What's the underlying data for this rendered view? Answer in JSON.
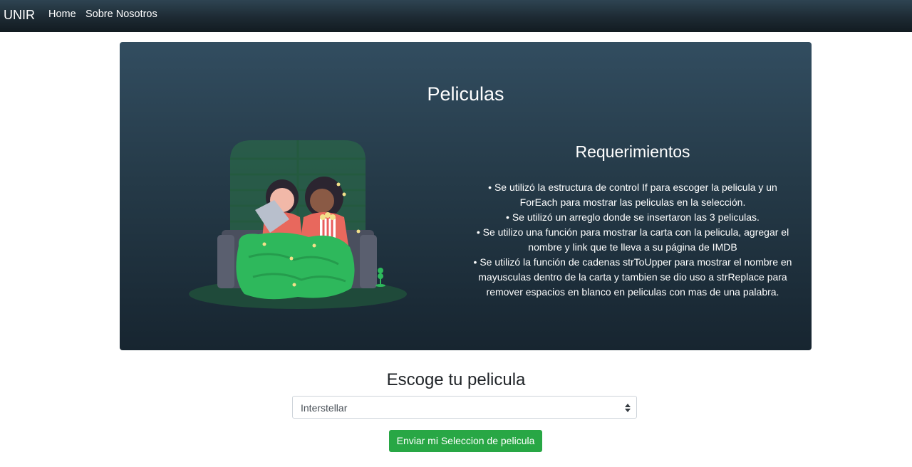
{
  "navbar": {
    "brand": "UNIR",
    "links": [
      {
        "label": "Home"
      },
      {
        "label": "Sobre Nosotros"
      }
    ]
  },
  "hero": {
    "title": "Peliculas",
    "illustration_icon": "couple-watching-movie-illustration",
    "requirements_title": "Requerimientos",
    "requirements": [
      "• Se utilizó la estructura de control If para escoger la pelicula y un ForEach para mostrar las peliculas en la selección.",
      "• Se utilizó un arreglo donde se insertaron las 3 peliculas.",
      "• Se utilizo una función para mostrar la carta con la pelicula, agregar el nombre y link que te lleva a su página de IMDB",
      "• Se utilizó la función de cadenas strToUpper para mostrar el nombre en mayusculas dentro de la carta y tambien se dio uso a strReplace para remover espacios en blanco en peliculas con mas de una palabra."
    ]
  },
  "form": {
    "title": "Escoge tu pelicula",
    "selected_option": "Interstellar",
    "submit_label": "Enviar mi Seleccion de pelicula"
  },
  "colors": {
    "navbar_bg": "#1d2a33",
    "hero_bg": "#253a48",
    "button_green": "#28a745",
    "accent_green": "#2eb85c"
  }
}
